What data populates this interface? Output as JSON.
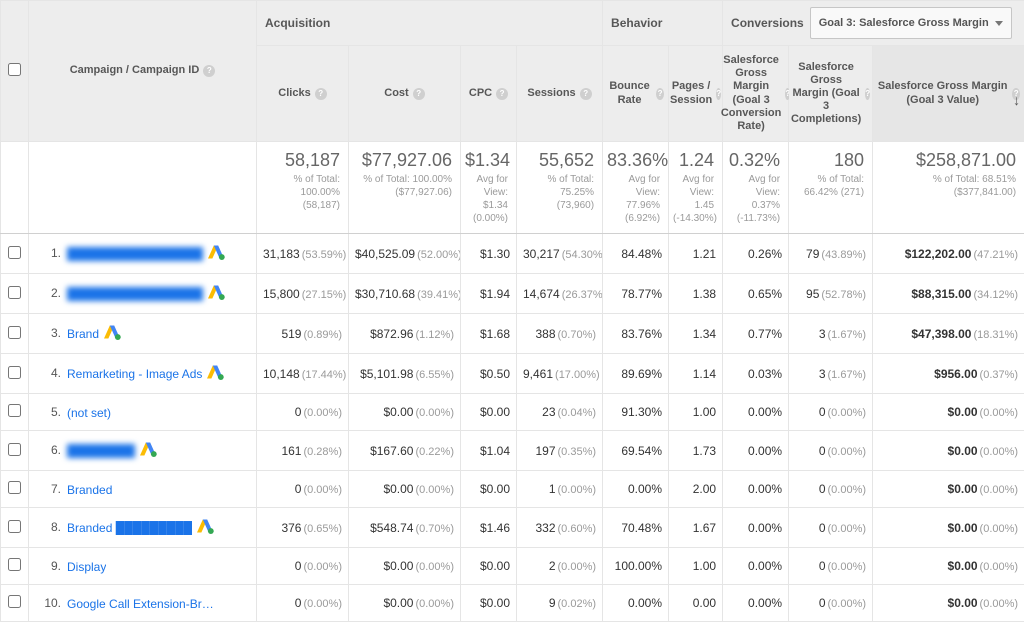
{
  "header": {
    "dimension_label": "Campaign / Campaign ID",
    "groups": {
      "acquisition": "Acquisition",
      "behavior": "Behavior",
      "conversions": "Conversions"
    },
    "conversion_selector": "Goal 3: Salesforce Gross Margin",
    "columns": {
      "clicks": "Clicks",
      "cost": "Cost",
      "cpc": "CPC",
      "sessions": "Sessions",
      "bounce_rate": "Bounce Rate",
      "pps": "Pages / Session",
      "conv_rate": "Salesforce Gross Margin (Goal 3 Conversion Rate)",
      "completions": "Salesforce Gross Margin (Goal 3 Completions)",
      "value": "Salesforce Gross Margin (Goal 3 Value)"
    }
  },
  "totals": {
    "clicks": {
      "big": "58,187",
      "sub": "% of Total: 100.00% (58,187)"
    },
    "cost": {
      "big": "$77,927.06",
      "sub": "% of Total: 100.00% ($77,927.06)"
    },
    "cpc": {
      "big": "$1.34",
      "sub": "Avg for View: $1.34 (0.00%)"
    },
    "sessions": {
      "big": "55,652",
      "sub": "% of Total: 75.25% (73,960)"
    },
    "bounce_rate": {
      "big": "83.36%",
      "sub": "Avg for View: 77.96% (6.92%)"
    },
    "pps": {
      "big": "1.24",
      "sub": "Avg for View: 1.45 (-14.30%)"
    },
    "conv_rate": {
      "big": "0.32%",
      "sub": "Avg for View: 0.37% (-11.73%)"
    },
    "completions": {
      "big": "180",
      "sub": "% of Total: 66.42% (271)"
    },
    "value": {
      "big": "$258,871.00",
      "sub": "% of Total: 68.51% ($377,841.00)"
    }
  },
  "rows": [
    {
      "num": "1.",
      "name": "████████████████",
      "blur": true,
      "icon": true,
      "clicks": "31,183",
      "clicks_pct": "(53.59%)",
      "cost": "$40,525.09",
      "cost_pct": "(52.00%)",
      "cpc": "$1.30",
      "sessions": "30,217",
      "sessions_pct": "(54.30%)",
      "bounce": "84.48%",
      "pps": "1.21",
      "rate": "0.26%",
      "compl": "79",
      "compl_pct": "(43.89%)",
      "value": "$122,202.00",
      "value_pct": "(47.21%)"
    },
    {
      "num": "2.",
      "name": "████████████████",
      "blur": true,
      "icon": true,
      "clicks": "15,800",
      "clicks_pct": "(27.15%)",
      "cost": "$30,710.68",
      "cost_pct": "(39.41%)",
      "cpc": "$1.94",
      "sessions": "14,674",
      "sessions_pct": "(26.37%)",
      "bounce": "78.77%",
      "pps": "1.38",
      "rate": "0.65%",
      "compl": "95",
      "compl_pct": "(52.78%)",
      "value": "$88,315.00",
      "value_pct": "(34.12%)"
    },
    {
      "num": "3.",
      "name": "Brand",
      "blur": false,
      "icon": true,
      "clicks": "519",
      "clicks_pct": "(0.89%)",
      "cost": "$872.96",
      "cost_pct": "(1.12%)",
      "cpc": "$1.68",
      "sessions": "388",
      "sessions_pct": "(0.70%)",
      "bounce": "83.76%",
      "pps": "1.34",
      "rate": "0.77%",
      "compl": "3",
      "compl_pct": "(1.67%)",
      "value": "$47,398.00",
      "value_pct": "(18.31%)"
    },
    {
      "num": "4.",
      "name": "Remarketing - Image Ads",
      "blur": false,
      "icon": true,
      "clicks": "10,148",
      "clicks_pct": "(17.44%)",
      "cost": "$5,101.98",
      "cost_pct": "(6.55%)",
      "cpc": "$0.50",
      "sessions": "9,461",
      "sessions_pct": "(17.00%)",
      "bounce": "89.69%",
      "pps": "1.14",
      "rate": "0.03%",
      "compl": "3",
      "compl_pct": "(1.67%)",
      "value": "$956.00",
      "value_pct": "(0.37%)"
    },
    {
      "num": "5.",
      "name": "(not set)",
      "blur": false,
      "icon": false,
      "clicks": "0",
      "clicks_pct": "(0.00%)",
      "cost": "$0.00",
      "cost_pct": "(0.00%)",
      "cpc": "$0.00",
      "sessions": "23",
      "sessions_pct": "(0.04%)",
      "bounce": "91.30%",
      "pps": "1.00",
      "rate": "0.00%",
      "compl": "0",
      "compl_pct": "(0.00%)",
      "value": "$0.00",
      "value_pct": "(0.00%)"
    },
    {
      "num": "6.",
      "name": "████████",
      "blur": true,
      "icon": true,
      "clicks": "161",
      "clicks_pct": "(0.28%)",
      "cost": "$167.60",
      "cost_pct": "(0.22%)",
      "cpc": "$1.04",
      "sessions": "197",
      "sessions_pct": "(0.35%)",
      "bounce": "69.54%",
      "pps": "1.73",
      "rate": "0.00%",
      "compl": "0",
      "compl_pct": "(0.00%)",
      "value": "$0.00",
      "value_pct": "(0.00%)"
    },
    {
      "num": "7.",
      "name": "Branded",
      "blur": false,
      "icon": false,
      "clicks": "0",
      "clicks_pct": "(0.00%)",
      "cost": "$0.00",
      "cost_pct": "(0.00%)",
      "cpc": "$0.00",
      "sessions": "1",
      "sessions_pct": "(0.00%)",
      "bounce": "0.00%",
      "pps": "2.00",
      "rate": "0.00%",
      "compl": "0",
      "compl_pct": "(0.00%)",
      "value": "$0.00",
      "value_pct": "(0.00%)"
    },
    {
      "num": "8.",
      "name": "Branded █████████",
      "blur": false,
      "icon": true,
      "clicks": "376",
      "clicks_pct": "(0.65%)",
      "cost": "$548.74",
      "cost_pct": "(0.70%)",
      "cpc": "$1.46",
      "sessions": "332",
      "sessions_pct": "(0.60%)",
      "bounce": "70.48%",
      "pps": "1.67",
      "rate": "0.00%",
      "compl": "0",
      "compl_pct": "(0.00%)",
      "value": "$0.00",
      "value_pct": "(0.00%)"
    },
    {
      "num": "9.",
      "name": "Display",
      "blur": false,
      "icon": false,
      "clicks": "0",
      "clicks_pct": "(0.00%)",
      "cost": "$0.00",
      "cost_pct": "(0.00%)",
      "cpc": "$0.00",
      "sessions": "2",
      "sessions_pct": "(0.00%)",
      "bounce": "100.00%",
      "pps": "1.00",
      "rate": "0.00%",
      "compl": "0",
      "compl_pct": "(0.00%)",
      "value": "$0.00",
      "value_pct": "(0.00%)"
    },
    {
      "num": "10.",
      "name": "Google Call Extension-Brand",
      "blur": false,
      "icon": false,
      "clicks": "0",
      "clicks_pct": "(0.00%)",
      "cost": "$0.00",
      "cost_pct": "(0.00%)",
      "cpc": "$0.00",
      "sessions": "9",
      "sessions_pct": "(0.02%)",
      "bounce": "0.00%",
      "pps": "0.00",
      "rate": "0.00%",
      "compl": "0",
      "compl_pct": "(0.00%)",
      "value": "$0.00",
      "value_pct": "(0.00%)"
    }
  ]
}
